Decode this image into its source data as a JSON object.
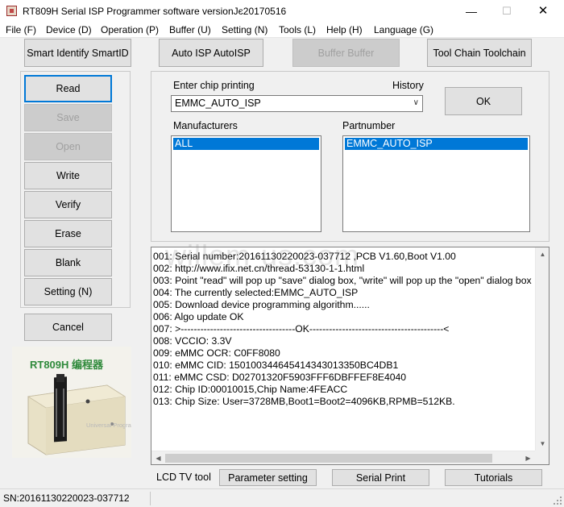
{
  "window": {
    "title": "RT809H Serial ISP Programmer software versionJє20170516",
    "minimize_glyph": "—",
    "maximize_glyph": "☐",
    "close_glyph": "✕"
  },
  "menu": [
    "File (F)",
    "Device (D)",
    "Operation (P)",
    "Buffer (U)",
    "Setting (N)",
    "Tools (L)",
    "Help (H)",
    "Language (G)"
  ],
  "toolbar": {
    "smart_identify": "Smart Identify SmartID",
    "auto_isp": "Auto ISP AutoISP",
    "buffer": "Buffer Buffer",
    "tool_chain": "Tool Chain Toolchain"
  },
  "actions": {
    "read": "Read",
    "save": "Save",
    "open": "Open",
    "write": "Write",
    "verify": "Verify",
    "erase": "Erase",
    "blank": "Blank",
    "setting": "Setting (N)",
    "cancel": "Cancel"
  },
  "chip": {
    "enter_label": "Enter chip printing",
    "history_label": "History",
    "value": "EMMC_AUTO_ISP",
    "ok": "OK",
    "manufacturers_label": "Manufacturers",
    "manufacturers_selected": "ALL",
    "partnumber_label": "Partnumber",
    "partnumber_selected": "EMMC_AUTO_ISP"
  },
  "log": [
    "001:  Serial number:20161130220023-037712  ,PCB V1.60,Boot V1.00",
    "002:  http://www.ifix.net.cn/thread-53130-1-1.html",
    "003:  Point \"read\" will pop up \"save\" dialog box, \"write\" will pop up the \"open\" dialog box",
    "004:  The currently selected:EMMC_AUTO_ISP",
    "005:  Download device programming algorithm......",
    "006:  Algo update OK",
    "007:  >-----------------------------------OK-----------------------------------------<",
    "008:  VCCIO: 3.3V",
    "009:  eMMC OCR: C0FF8080",
    "010:  eMMC CID:  150100344645414343013350BC4DB1",
    "011:  eMMC CSD: D02701320F5903FFF6DBFFEF8E4040",
    "012:  Chip ID:00010015,Chip Name:4FEACC",
    "013:  Chip Size: User=3728MB,Boot1=Boot2=4096KB,RPMB=512KB."
  ],
  "watermark": "willem-us.com",
  "photo": {
    "caption": "RT809H 编程器",
    "device_label": "Universal Programmer"
  },
  "bottom": {
    "lcd_tv_tool": "LCD TV tool",
    "parameter_setting": "Parameter setting",
    "serial_print": "Serial Print",
    "tutorials": "Tutorials"
  },
  "status": {
    "serial": "SN:20161130220023-037712"
  },
  "colors": {
    "selection": "#0078d7",
    "focus_border": "#0078d7",
    "caption_green": "#2f8a3b"
  }
}
